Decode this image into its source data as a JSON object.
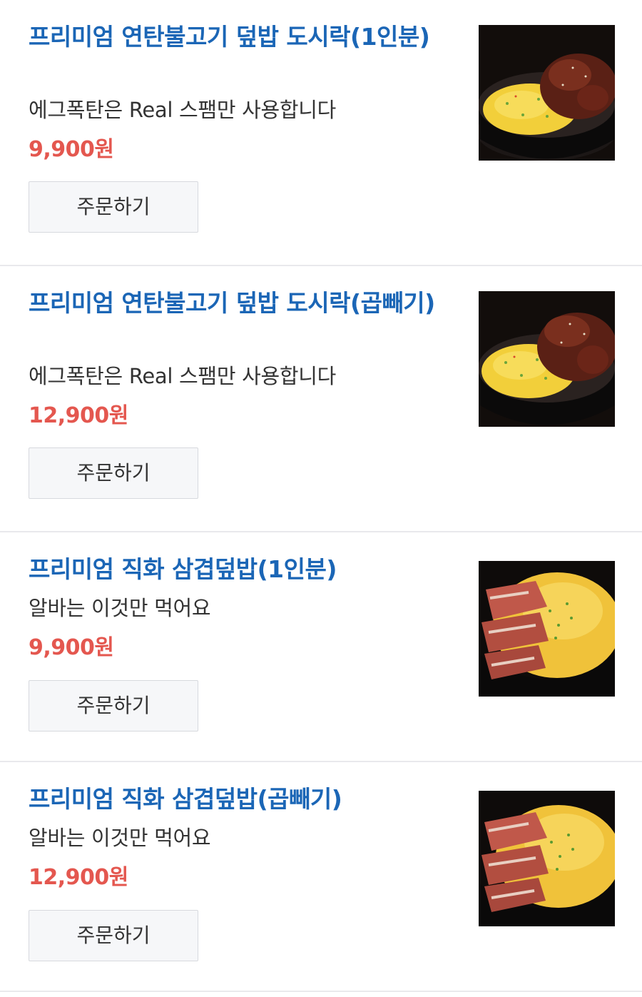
{
  "menu": {
    "order_label": "주문하기",
    "items": [
      {
        "title": "프리미엄 연탄불고기 덮밥 도시락(1인분)",
        "description": "에그폭탄은 Real 스팸만 사용합니다",
        "price": "9,900원",
        "image_icon": "bulgogi-rice-bowl-photo"
      },
      {
        "title": "프리미엄 연탄불고기 덮밥 도시락(곱빼기)",
        "description": "에그폭탄은 Real 스팸만 사용합니다",
        "price": "12,900원",
        "image_icon": "bulgogi-rice-bowl-photo"
      },
      {
        "title": "프리미엄 직화 삼겹덮밥(1인분)",
        "description": "알바는 이것만 먹어요",
        "price": "9,900원",
        "image_icon": "pork-belly-rice-bowl-photo"
      },
      {
        "title": "프리미엄 직화 삼겹덮밥(곱빼기)",
        "description": "알바는 이것만 먹어요",
        "price": "12,900원",
        "image_icon": "pork-belly-rice-bowl-photo"
      }
    ]
  },
  "colors": {
    "title": "#1b66b6",
    "price": "#e4574f",
    "text": "#333333",
    "divider": "#e9e9ec",
    "button_bg": "#f6f7f9"
  }
}
